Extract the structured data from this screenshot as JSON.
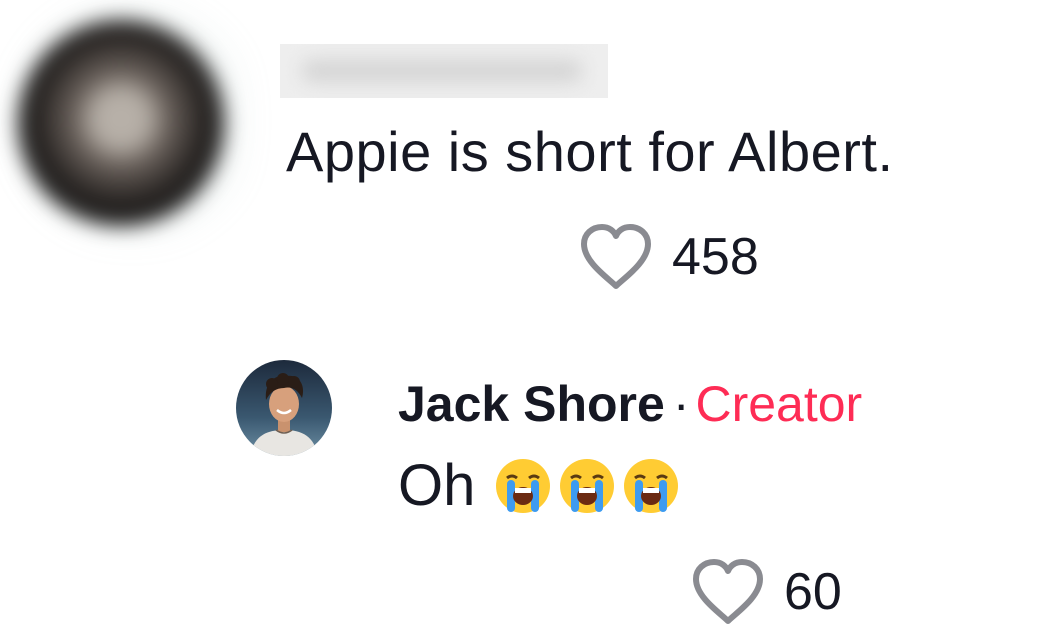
{
  "comment": {
    "text": "Appie is short for Albert.",
    "like_count": "458",
    "icons": {
      "avatar": "blurred-avatar",
      "like": "heart-outline-icon"
    }
  },
  "reply": {
    "author": "Jack Shore",
    "separator": "·",
    "badge": "Creator",
    "text": "Oh",
    "emojis": [
      "loudly-crying-face",
      "loudly-crying-face",
      "loudly-crying-face"
    ],
    "like_count": "60"
  },
  "colors": {
    "text": "#161823",
    "creator_badge": "#fe2c55",
    "heart_stroke": "#8a8b91",
    "background": "#ffffff"
  }
}
